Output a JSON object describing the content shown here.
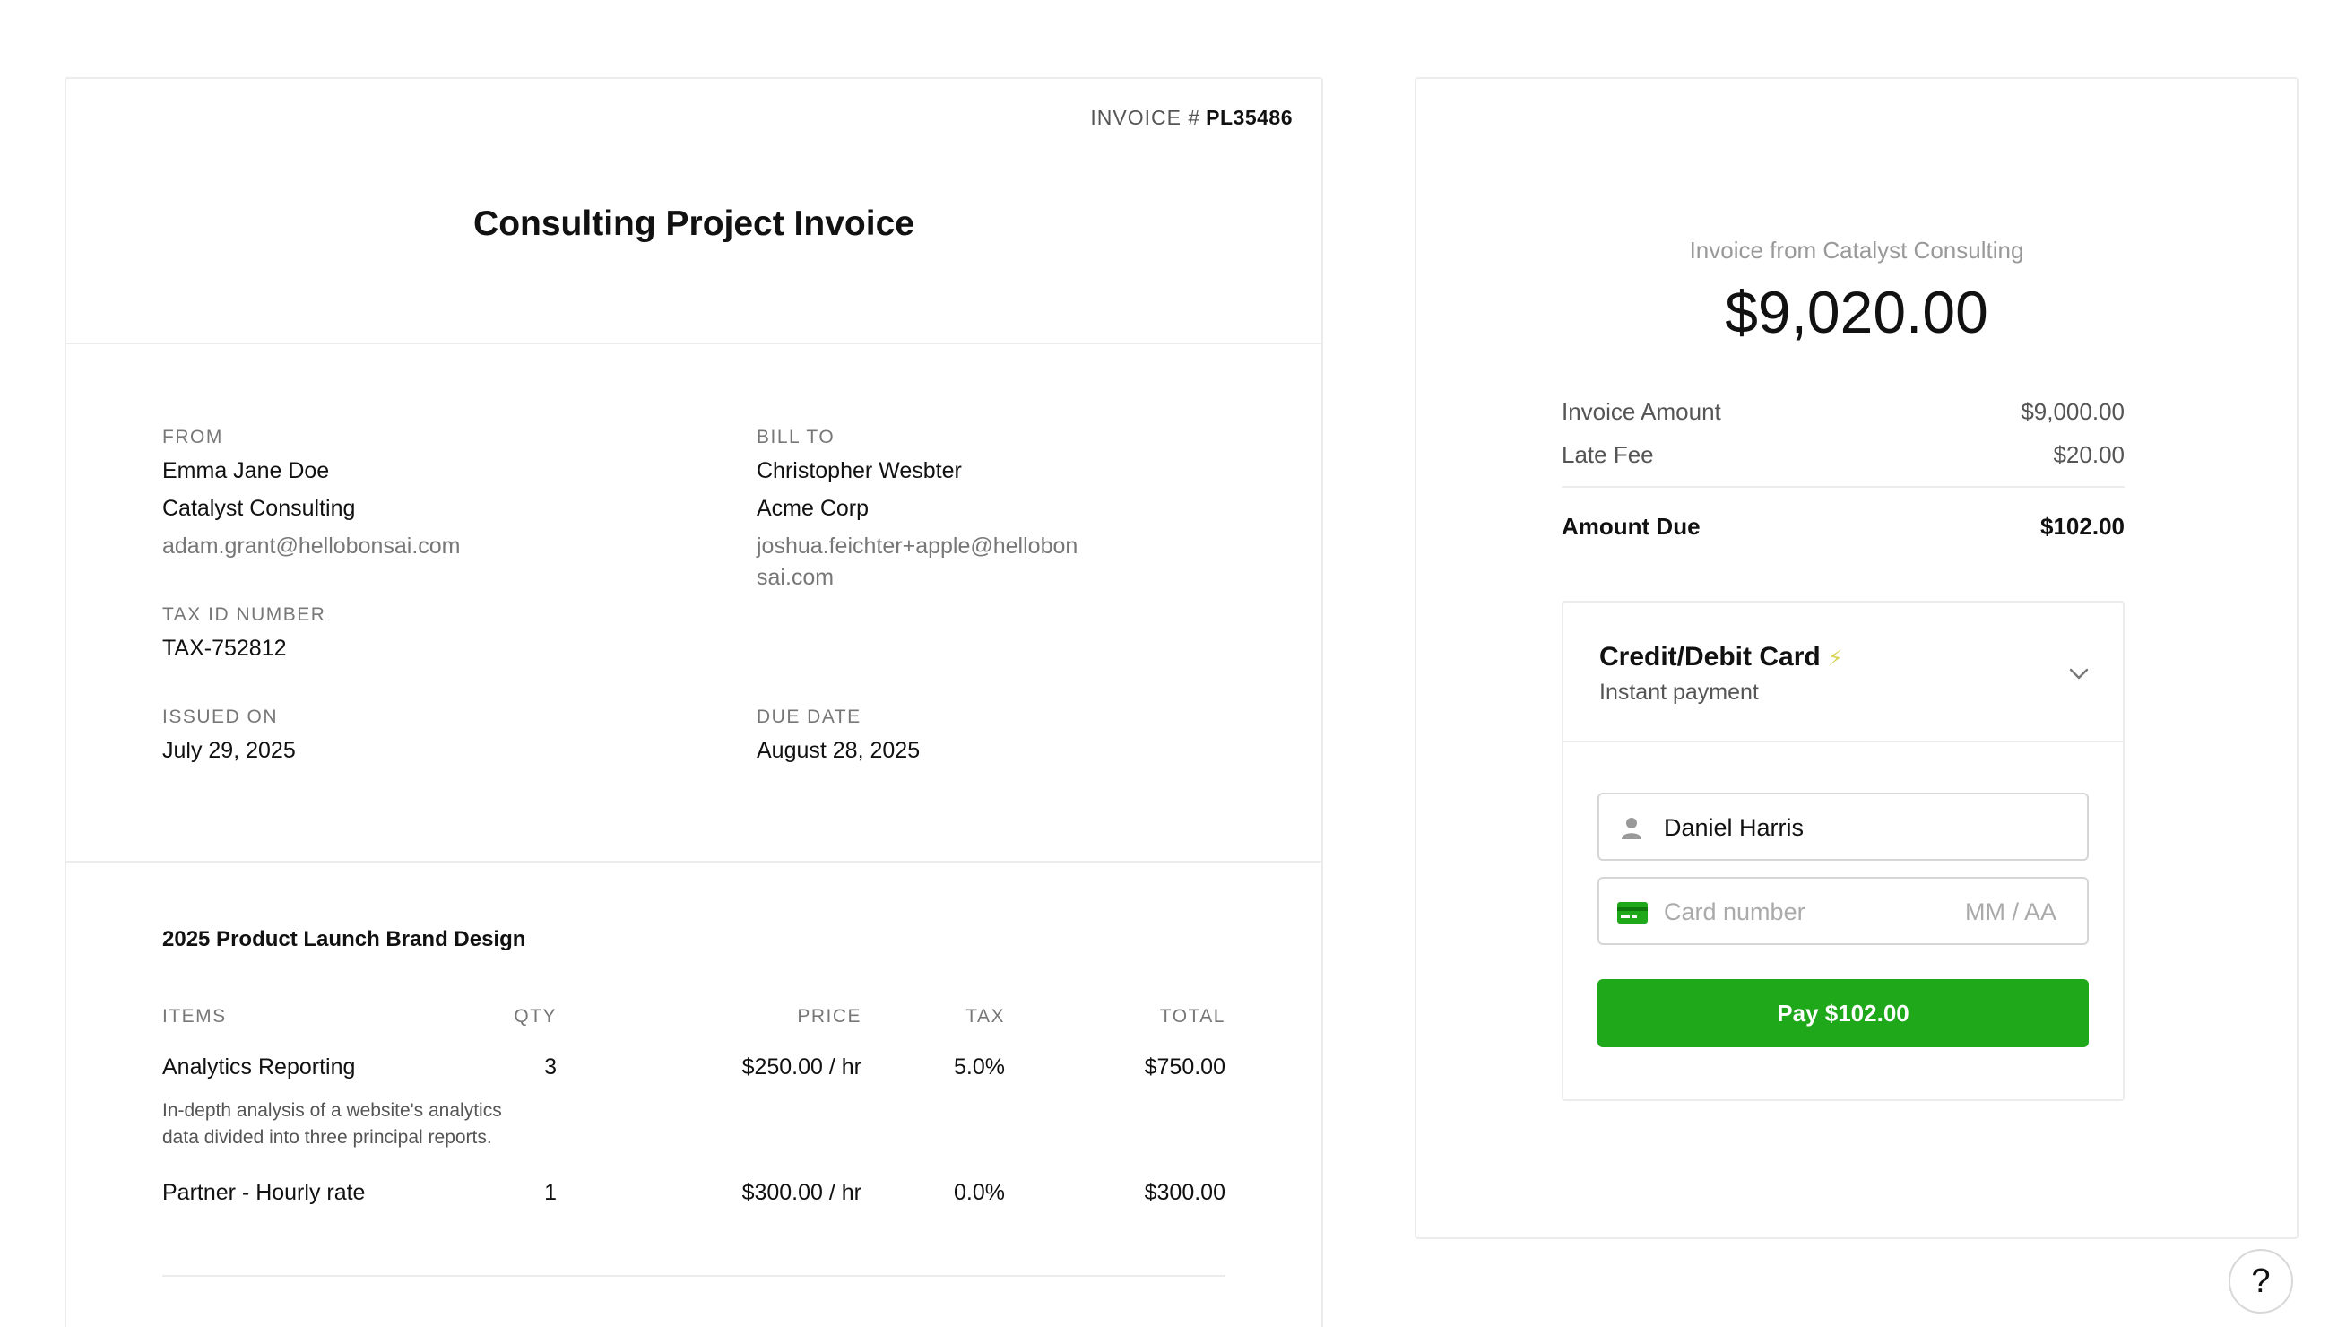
{
  "invoice": {
    "number_label": "INVOICE #",
    "number": "PL35486",
    "title": "Consulting Project Invoice",
    "from": {
      "label": "FROM",
      "name": "Emma Jane Doe",
      "company": "Catalyst Consulting",
      "email": "adam.grant@hellobonsai.com"
    },
    "bill_to": {
      "label": "BILL TO",
      "name": "Christopher Wesbter",
      "company": "Acme Corp",
      "email_line1": "joshua.feichter+apple@hellobon",
      "email_line2": "sai.com"
    },
    "tax_id": {
      "label": "TAX ID NUMBER",
      "value": "TAX-752812"
    },
    "issued_on": {
      "label": "ISSUED ON",
      "value": "July 29, 2025"
    },
    "due_date": {
      "label": "DUE DATE",
      "value": "August 28, 2025"
    },
    "project_title": "2025 Product Launch Brand Design",
    "columns": {
      "items": "ITEMS",
      "qty": "QTY",
      "price": "PRICE",
      "tax": "TAX",
      "total": "TOTAL"
    },
    "rows": [
      {
        "item": "Analytics Reporting",
        "description_line1": "In-depth analysis of a website's analytics",
        "description_line2": "data divided into three principal reports.",
        "qty": "3",
        "price": "$250.00 / hr",
        "tax": "5.0%",
        "total": "$750.00"
      },
      {
        "item": "Partner - Hourly rate",
        "qty": "1",
        "price": "$300.00 / hr",
        "tax": "0.0%",
        "total": "$300.00"
      }
    ]
  },
  "payment": {
    "from_label": "Invoice from Catalyst Consulting",
    "total": "$9,020.00",
    "invoice_amount_label": "Invoice Amount",
    "invoice_amount": "$9,000.00",
    "late_fee_label": "Late Fee",
    "late_fee": "$20.00",
    "amount_due_label": "Amount Due",
    "amount_due": "$102.00",
    "method_title": "Credit/Debit Card",
    "method_subtitle": "Instant payment",
    "name_value": "Daniel Harris",
    "card_placeholder": "Card number",
    "expiry_placeholder": "MM / AA",
    "pay_button": "Pay $102.00",
    "accent_color": "#1ea81a"
  },
  "help": {
    "label": "?"
  }
}
